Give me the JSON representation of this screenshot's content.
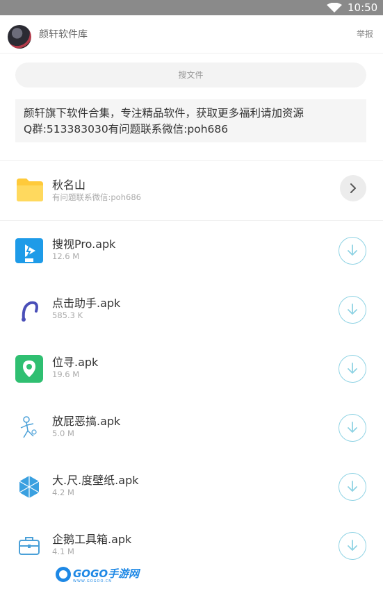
{
  "status_bar": {
    "time": "10:50"
  },
  "header": {
    "title": "颜轩软件库",
    "report_label": "举报"
  },
  "search": {
    "placeholder": "搜文件"
  },
  "notice": {
    "line1": "颜轩旗下软件合集，专注精品软件，获取更多福利请加资源",
    "line2": "Q群:513383030有问题联系微信:poh686"
  },
  "folder": {
    "name": "秋名山",
    "meta": "有问题联系微信:poh686"
  },
  "files": [
    {
      "name": "搜视Pro.apk",
      "size": "12.6 M",
      "icon": "soushi-pro-app-icon"
    },
    {
      "name": "点击助手.apk",
      "size": "585.3 K",
      "icon": "click-assistant-app-icon"
    },
    {
      "name": "位寻.apk",
      "size": "19.6 M",
      "icon": "location-app-icon"
    },
    {
      "name": "放屁恶搞.apk",
      "size": "5.0 M",
      "icon": "prank-app-icon"
    },
    {
      "name": "大.尺.度壁纸.apk",
      "size": "4.2 M",
      "icon": "wallpaper-app-icon"
    },
    {
      "name": "企鹅工具箱.apk",
      "size": "4.1 M",
      "icon": "toolbox-app-icon"
    }
  ],
  "watermark": {
    "text": "GOGO手游网",
    "sub": "WWW.GOGOO.CN"
  },
  "colors": {
    "accent": "#8fd3e4",
    "folder": "#ffd54f",
    "status_bar": "#8a8a8a"
  }
}
